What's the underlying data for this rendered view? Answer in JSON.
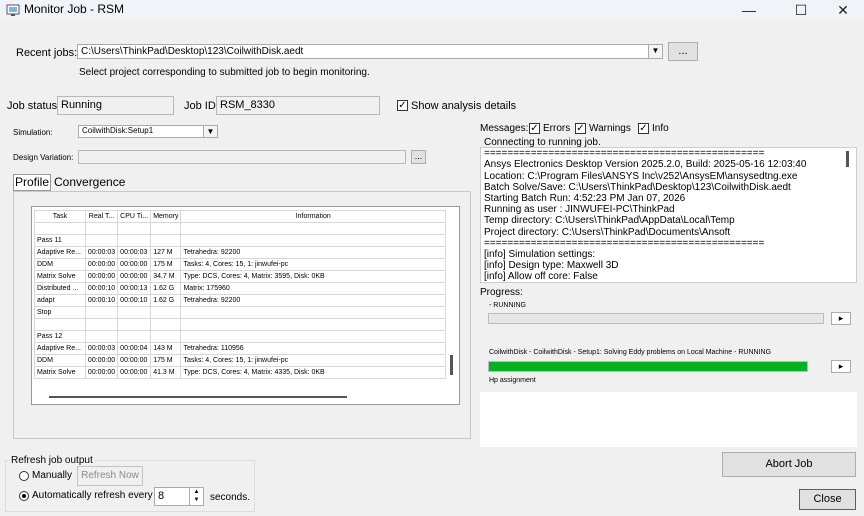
{
  "window": {
    "title": "Monitor Job - RSM",
    "minimize": "—",
    "maximize": "☐",
    "close": "✕"
  },
  "recent": {
    "label": "Recent jobs:",
    "value": "C:\\Users\\ThinkPad\\Desktop\\123\\CoilwithDisk.aedt",
    "browse": "...",
    "hint": "Select project corresponding to submitted job to begin monitoring."
  },
  "job": {
    "status_label": "Job status:",
    "status": "Running",
    "id_label": "Job ID:",
    "id": "RSM_8330",
    "show_details": "Show analysis details"
  },
  "simulation": {
    "label": "Simulation:",
    "value": "CoilwithDisk:Setup1"
  },
  "design_variation": {
    "label": "Design Variation:",
    "value": "",
    "button": "..."
  },
  "tabs": {
    "profile": "Profile",
    "convergence": "Convergence"
  },
  "table": {
    "headers": [
      "Task",
      "Real T...",
      "CPU Ti...",
      "Memory",
      "Information"
    ],
    "rows": [
      [
        "",
        "",
        "",
        "",
        ""
      ],
      [
        "Pass 11",
        "",
        "",
        "",
        ""
      ],
      [
        "Adaptive Re...",
        "00:00:03",
        "00:00:03",
        "127 M",
        "Tetrahedra: 92200"
      ],
      [
        "DDM",
        "00:00:00",
        "00:00:00",
        "175 M",
        "Tasks: 4, Cores: 15, 1: jinwufei-pc"
      ],
      [
        "Matrix Solve",
        "00:00:00",
        "00:00:00",
        "34.7 M",
        "Type: DCS, Cores: 4, Matrix: 3595, Disk: 0KB"
      ],
      [
        "Distributed ...",
        "00:00:10",
        "00:00:13",
        "1.62 G",
        "Matrix: 175960"
      ],
      [
        "adapt",
        "00:00:10",
        "00:00:10",
        "1.62 G",
        "Tetrahedra: 92200"
      ],
      [
        "Stop",
        "",
        "",
        "",
        ""
      ],
      [
        "",
        "",
        "",
        "",
        ""
      ],
      [
        "Pass 12",
        "",
        "",
        "",
        ""
      ],
      [
        "Adaptive Re...",
        "00:00:03",
        "00:00:04",
        "143 M",
        "Tetrahedra: 110956"
      ],
      [
        "DDM",
        "00:00:00",
        "00:00:00",
        "175 M",
        "Tasks: 4, Cores: 15, 1: jinwufei-pc"
      ],
      [
        "Matrix Solve",
        "00:00:00",
        "00:00:00",
        "41.3 M",
        "Type: DCS, Cores: 4, Matrix: 4335, Disk: 0KB"
      ]
    ]
  },
  "messages": {
    "label": "Messages:",
    "errors": "Errors",
    "warnings": "Warnings",
    "info": "Info",
    "lines": [
      "Connecting to running job.",
      "================================================",
      "Ansys Electronics Desktop Version 2025.2.0, Build: 2025-05-16 12:03:40",
      "Location: C:\\Program Files\\ANSYS Inc\\v252\\AnsysEM\\ansysedtng.exe",
      "Batch Solve/Save: C:\\Users\\ThinkPad\\Desktop\\123\\CoilwithDisk.aedt",
      "Starting Batch Run: 4:52:23 PM  Jan 07, 2026",
      "Running as user : JINWUFEI-PC\\ThinkPad",
      "Temp directory: C:\\Users\\ThinkPad\\AppData\\Local\\Temp",
      "Project directory: C:\\Users\\ThinkPad\\Documents\\Ansoft",
      "================================================",
      "[info] Simulation settings:",
      "[info] Design type: Maxwell 3D",
      "[info] Allow off core: False"
    ]
  },
  "progress": {
    "label": "Progress:",
    "overall_text": "- RUNNING",
    "overall_fraction": 0,
    "task_text": "CoilwithDisk - CoilwithDisk - Setup1: Solving Eddy problems on Local Machine - RUNNING",
    "task_fraction": 1.0,
    "task_color": "#06b025",
    "sub_text": "Hp assignment",
    "expand": "▸"
  },
  "refresh": {
    "group_label": "Refresh job output",
    "manual": "Manually",
    "refresh_now": "Refresh Now",
    "auto": "Automatically refresh every",
    "interval": "8",
    "seconds": "seconds."
  },
  "actions": {
    "abort": "Abort Job",
    "close": "Close"
  }
}
